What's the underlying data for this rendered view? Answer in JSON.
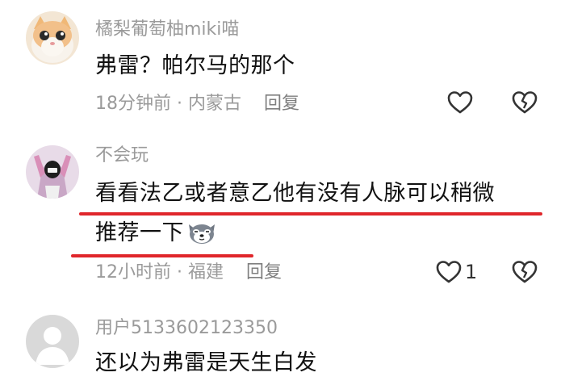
{
  "comments": [
    {
      "username": "橘梨葡萄柚miki喵",
      "text": "弗雷？帕尔马的那个",
      "time_location": "18分钟前 · 内蒙古",
      "reply_label": "回复",
      "like_count": ""
    },
    {
      "username": "不会玩",
      "text_line1": "看看法乙或者意乙他有没有人脉可以稍微",
      "text_line2": "推荐一下",
      "emoji": "husky-emoji",
      "time_location": "12小时前 · 福建",
      "reply_label": "回复",
      "like_count": "1"
    },
    {
      "username": "用户5133602123350",
      "text": "还以为弗雷是天生白发"
    }
  ],
  "colors": {
    "highlight_underline": "#e0262b",
    "muted_text": "#9a9a9a",
    "body_text": "#111111"
  },
  "icons": [
    "heart-icon",
    "broken-heart-icon",
    "husky-emoji-icon"
  ]
}
